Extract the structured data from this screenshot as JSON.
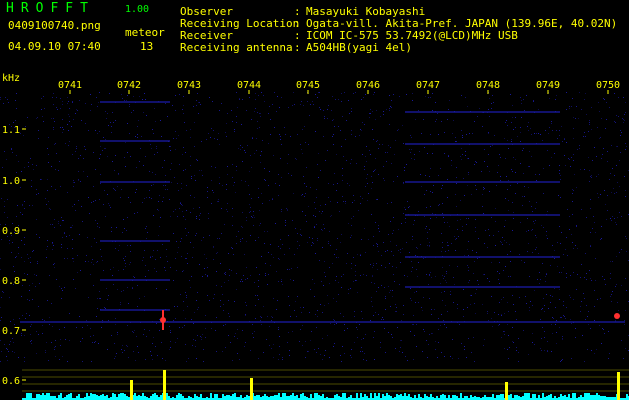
{
  "app": {
    "name": "HROFFT",
    "version": "1.00"
  },
  "file": {
    "name": "0409100740.png",
    "datetime": "04.09.10 07:40"
  },
  "counter": {
    "label": "meteor",
    "value": "13"
  },
  "meta": [
    {
      "label": "Observer",
      "value": "Masayuki Kobayashi"
    },
    {
      "label": "Receiving Location",
      "value": "Ogata-vill. Akita-Pref. JAPAN (139.96E, 40.02N)"
    },
    {
      "label": "Receiver",
      "value": "ICOM IC-575 53.7492(@LCD)MHz USB"
    },
    {
      "label": "Receiving antenna",
      "value": "A504HB(yagi 4el)"
    }
  ],
  "colon": ":",
  "axis": {
    "unit": "kHz",
    "time_ticks": [
      "0741",
      "0742",
      "0743",
      "0744",
      "0745",
      "0746",
      "0747",
      "0748",
      "0749",
      "0750"
    ],
    "freq_ticks": [
      "1.1",
      "1.0",
      "0.9",
      "0.8",
      "0.7",
      "0.6"
    ]
  },
  "colors": {
    "background": "#000000",
    "text": "#ffff00",
    "title": "#00ff00",
    "noise": "#1a1aa0",
    "meteor": "#ff3030",
    "level": "#00ffff"
  }
}
